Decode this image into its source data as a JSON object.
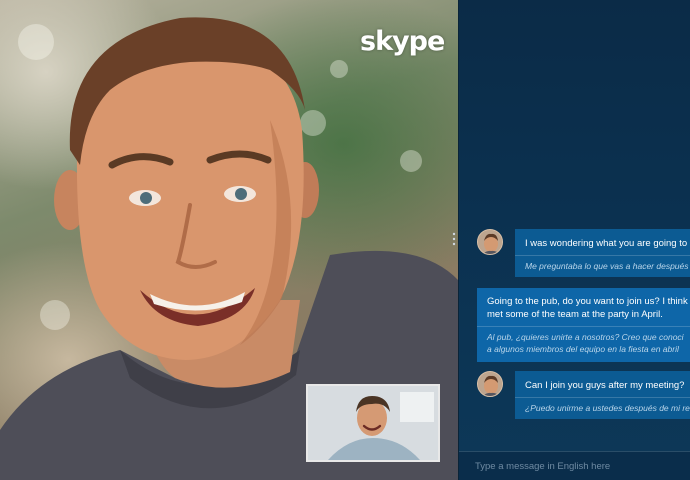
{
  "brand": {
    "logo_text": "skype"
  },
  "icons": {
    "more": "vertical-dots-icon"
  },
  "chat": {
    "messages": [
      {
        "direction": "incoming",
        "text": "I was wondering what you are going to do",
        "translation": "Me preguntaba lo que vas a hacer después"
      },
      {
        "direction": "outgoing",
        "text_line1": "Going to the pub, do you want to join us? I think you",
        "text_line2": "met some of the team at the party in April.",
        "translation_line1": "Al pub, ¿quieres unirte a nosotros? Creo que conoci",
        "translation_line2": "a algunos miembros del equipo en la fiesta en abril"
      },
      {
        "direction": "incoming",
        "text": "Can I join you guys after my meeting?",
        "translation": "¿Puedo unirme a ustedes después de mi reu"
      }
    ],
    "composer": {
      "placeholder": "Type a message in English here",
      "value": ""
    }
  },
  "colors": {
    "panel_bg": "#0b3150",
    "bubble_incoming": "#0c5b93",
    "bubble_outgoing": "#0e66a8",
    "translation_text": "#b9d5ea"
  }
}
